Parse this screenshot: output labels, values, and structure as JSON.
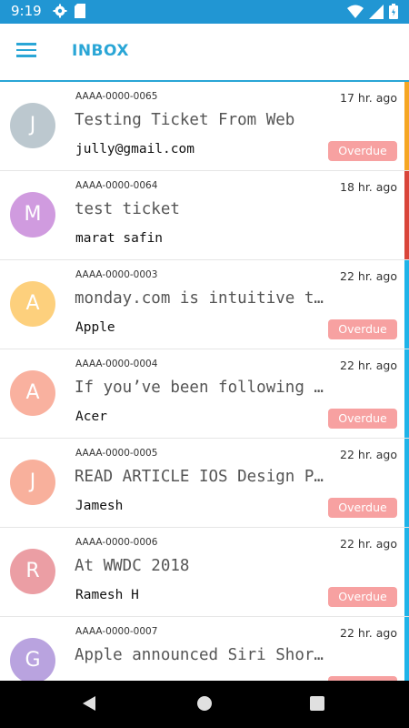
{
  "status_bar": {
    "time": "9:19",
    "icons": [
      "gear-icon",
      "sd-card-icon",
      "wifi-icon",
      "signal-icon",
      "battery-icon"
    ]
  },
  "header": {
    "title": "INBOX",
    "menu_icon": "hamburger-icon",
    "accent_color": "#2aa6d6"
  },
  "colors": {
    "status_bar": "#2196d3",
    "overdue_badge": "#f7a1a1"
  },
  "tickets": [
    {
      "id": "AAAA-0000-0065",
      "time": "17 hr. ago",
      "subject": "Testing Ticket From Web",
      "requester": "jully@gmail.com",
      "initial": "J",
      "avatar_color": "#bcc8cf",
      "badge": "Overdue",
      "priority_color": "#f5a623"
    },
    {
      "id": "AAAA-0000-0064",
      "time": "18 hr. ago",
      "subject": "test ticket",
      "requester": "marat safin",
      "initial": "M",
      "avatar_color": "#d09bdf",
      "badge": "",
      "priority_color": "#d9453a"
    },
    {
      "id": "AAAA-0000-0003",
      "time": "22 hr. ago",
      "subject": "monday.com is intuitive to use",
      "requester": "Apple",
      "initial": "A",
      "avatar_color": "#fdd07d",
      "badge": "Overdue",
      "priority_color": "#1fb3e8"
    },
    {
      "id": "AAAA-0000-0004",
      "time": "22 hr. ago",
      "subject": "If you’ve been following along",
      "requester": "Acer",
      "initial": "A",
      "avatar_color": "#f9b19f",
      "badge": "Overdue",
      "priority_color": "#1fb3e8"
    },
    {
      "id": "AAAA-0000-0005",
      "time": "22 hr. ago",
      "subject": "READ ARTICLE IOS Design Patterns",
      "requester": "Jamesh",
      "initial": "J",
      "avatar_color": "#f8b09c",
      "badge": "Overdue",
      "priority_color": "#1fb3e8"
    },
    {
      "id": "AAAA-0000-0006",
      "time": "22 hr. ago",
      "subject": "At WWDC 2018",
      "requester": "Ramesh H",
      "initial": "R",
      "avatar_color": "#eb9ea4",
      "badge": "Overdue",
      "priority_color": "#1fb3e8"
    },
    {
      "id": "AAAA-0000-0007",
      "time": "22 hr. ago",
      "subject": " Apple announced Siri Shortcuts",
      "requester": "",
      "initial": "G",
      "avatar_color": "#b9a3df",
      "badge": "Overdue",
      "priority_color": "#1fb3e8"
    }
  ],
  "nav_bar": {
    "back_icon": "back-triangle-icon",
    "home_icon": "home-circle-icon",
    "recent_icon": "recent-apps-square-icon"
  }
}
